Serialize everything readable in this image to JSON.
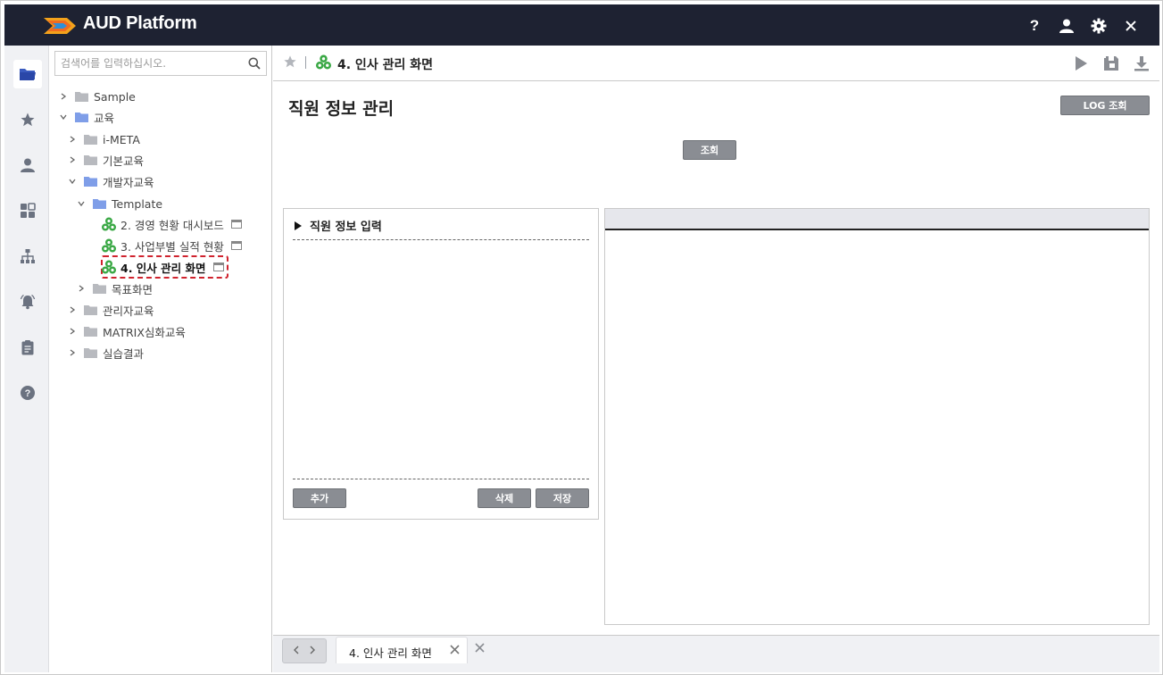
{
  "app": {
    "title": "AUD Platform"
  },
  "titlebar": {
    "help_label": "?"
  },
  "tree": {
    "search_placeholder": "검색어를 입력하십시오.",
    "nodes": {
      "sample": "Sample",
      "education": "교육",
      "imeta": "i-META",
      "basic": "기본교육",
      "developer": "개발자교육",
      "template": "Template",
      "report2": "2. 경영 현황 대시보드",
      "report3": "3. 사업부별 실적 현황",
      "report4": "4. 인사 관리 화면",
      "target": "목표화면",
      "admin": "관리자교육",
      "matrix": "MATRIX심화교육",
      "practice": "실습결과"
    }
  },
  "breadcrumb": {
    "title": "4. 인사 관리 화면"
  },
  "main": {
    "page_title": "직원 정보 관리",
    "log_button": "LOG 조회",
    "query_button": "조회",
    "form": {
      "header": "직원 정보 입력",
      "add_button": "추가",
      "delete_button": "삭제",
      "save_button": "저장"
    }
  },
  "tabs": {
    "items": [
      {
        "label": "4. 인사 관리 화면"
      }
    ]
  },
  "colors": {
    "titlebar_bg": "#1e2232",
    "button_gray": "#8a8d93",
    "report_icon_green": "#3aa845",
    "selection_border": "#d0232e",
    "folder_blue": "#7f9ee8",
    "folder_gray": "#b8babf"
  },
  "icons": {
    "rail": [
      "folder-open-icon",
      "star-icon",
      "user-icon",
      "dashboard-icon",
      "org-chart-icon",
      "alarm-bell-icon",
      "clipboard-icon",
      "help-circle-icon"
    ],
    "toolbar": [
      "play-icon",
      "save-icon",
      "download-icon"
    ]
  }
}
